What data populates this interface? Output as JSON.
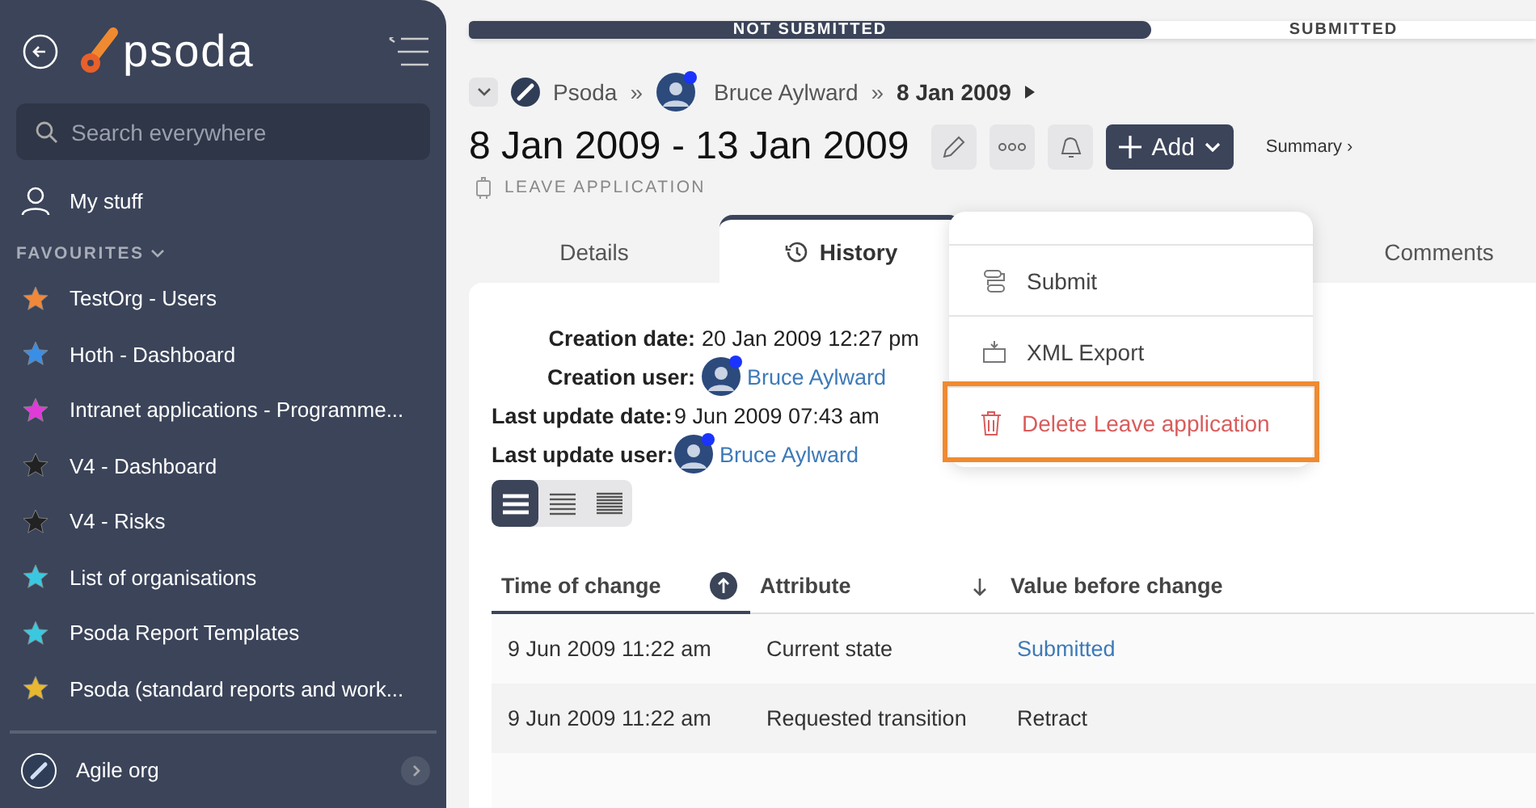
{
  "sidebar": {
    "logo": "psoda",
    "search": {
      "placeholder": "Search everywhere"
    },
    "my_stuff": "My stuff",
    "favourites_heading": "FAVOURITES",
    "favourites": [
      {
        "label": "TestOrg - Users",
        "color": "#f0883a"
      },
      {
        "label": "Hoth - Dashboard",
        "color": "#3a8ee6"
      },
      {
        "label": "Intranet applications - Programme...",
        "color": "#e03ad8"
      },
      {
        "label": "V4 - Dashboard",
        "color": "#222222"
      },
      {
        "label": "V4 - Risks",
        "color": "#222222"
      },
      {
        "label": "List of organisations",
        "color": "#3ac8e0"
      },
      {
        "label": "Psoda Report Templates",
        "color": "#3ac8e0"
      },
      {
        "label": "Psoda (standard reports and work...",
        "color": "#e8b830"
      }
    ],
    "org": "Agile org"
  },
  "progress": [
    {
      "label": "NOT SUBMITTED",
      "selected": true
    },
    {
      "label": "SUBMITTED",
      "selected": false
    }
  ],
  "breadcrumb_separator": "»",
  "breadcrumb": [
    {
      "label": "Psoda",
      "kind": "org"
    },
    {
      "label": "Bruce Aylward",
      "kind": "user"
    },
    {
      "label": "8 Jan 2009",
      "kind": "current"
    }
  ],
  "title": "8 Jan 2009 - 13 Jan 2009",
  "subtitle": "LEAVE APPLICATION",
  "add_button": "Add",
  "summary_link": "Summary ›",
  "menu": [
    {
      "label": "Submit",
      "kind": "submit",
      "highlighted": false
    },
    {
      "label": "XML Export",
      "kind": "export",
      "highlighted": false
    },
    {
      "label": "Delete Leave application",
      "kind": "delete",
      "highlighted": true
    }
  ],
  "tabs": [
    {
      "label": "Details",
      "selected": false
    },
    {
      "label": "History",
      "selected": true
    },
    {
      "label": "Comments",
      "selected": false
    }
  ],
  "meta": [
    {
      "label": "Creation date:",
      "value": "20 Jan 2009 12:27 pm",
      "kind": "text"
    },
    {
      "label": "Creation user:",
      "value": "Bruce Aylward",
      "kind": "user"
    },
    {
      "label": "Last update date:",
      "value": "9 Jun 2009 07:43 am",
      "kind": "text"
    },
    {
      "label": "Last update user:",
      "value": "Bruce Aylward",
      "kind": "user"
    }
  ],
  "view_modes": [
    {
      "selected": true
    },
    {
      "selected": false
    },
    {
      "selected": false
    }
  ],
  "table": {
    "columns": [
      {
        "label": "Time of change",
        "kind": "sorted"
      },
      {
        "label": "Attribute",
        "kind": "sortable"
      },
      {
        "label": "Value before change",
        "kind": "plain"
      }
    ],
    "rows": [
      {
        "cells": [
          {
            "text": "9 Jun 2009 11:22 am",
            "kind": "text"
          },
          {
            "text": "Current state",
            "kind": "text"
          },
          {
            "text": "Submitted",
            "kind": "link"
          }
        ]
      },
      {
        "cells": [
          {
            "text": "9 Jun 2009 11:22 am",
            "kind": "text"
          },
          {
            "text": "Requested transition",
            "kind": "text"
          },
          {
            "text": "Retract",
            "kind": "text"
          }
        ]
      }
    ]
  }
}
